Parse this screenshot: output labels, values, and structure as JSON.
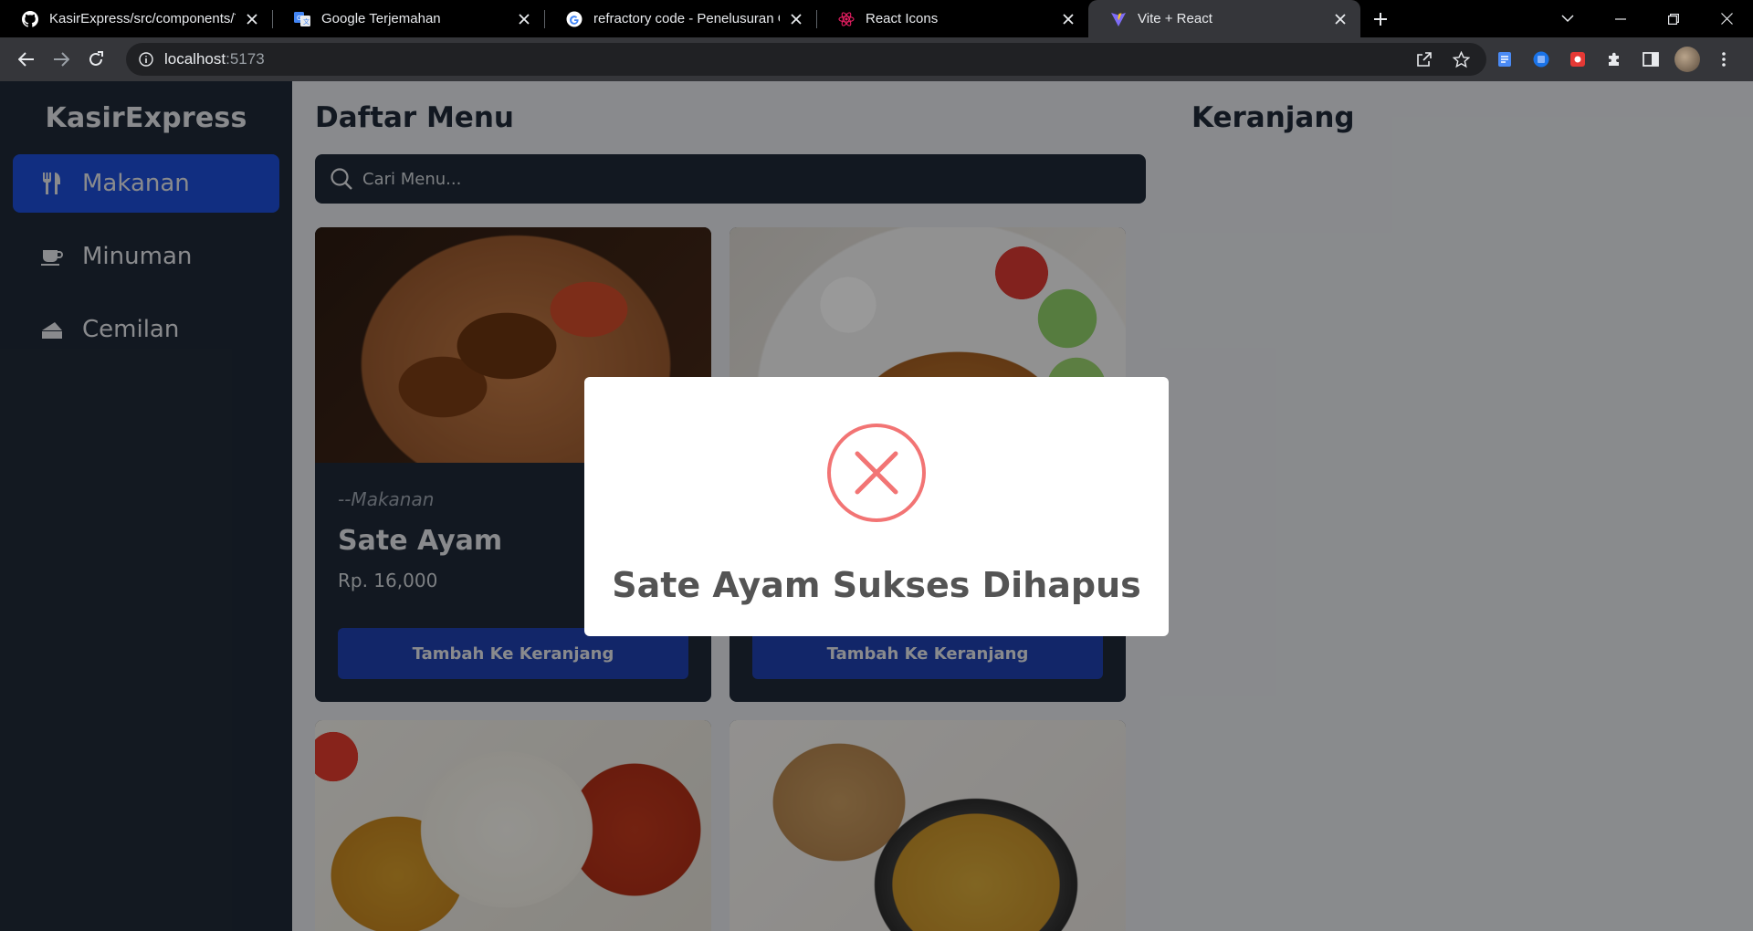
{
  "browser": {
    "tabs": [
      {
        "title": "KasirExpress/src/components/Tot",
        "favicon": "github-icon",
        "active": false
      },
      {
        "title": "Google Terjemahan",
        "favicon": "google-translate-icon",
        "active": false
      },
      {
        "title": "refractory code - Penelusuran Go",
        "favicon": "google-icon",
        "active": false
      },
      {
        "title": "React Icons",
        "favicon": "react-icon",
        "active": false
      },
      {
        "title": "Vite + React",
        "favicon": "vite-icon",
        "active": true
      }
    ],
    "address": {
      "host": "localhost",
      "port": ":5173"
    }
  },
  "app": {
    "brand": "KasirExpress",
    "nav": [
      {
        "label": "Makanan",
        "icon": "utensils-icon",
        "active": true
      },
      {
        "label": "Minuman",
        "icon": "coffee-icon",
        "active": false
      },
      {
        "label": "Cemilan",
        "icon": "cake-icon",
        "active": false
      }
    ],
    "menu_title": "Daftar Menu",
    "search_placeholder": "Cari Menu...",
    "cart_title": "Keranjang",
    "cards": [
      {
        "category": "--Makanan",
        "name": "Sate Ayam",
        "price": "Rp. 16,000",
        "button": "Tambah Ke Keranjang"
      },
      {
        "category": "",
        "name": "",
        "price": "",
        "button": "Tambah Ke Keranjang"
      }
    ]
  },
  "modal": {
    "title": "Sate Ayam Sukses Dihapus",
    "icon": "error-x-icon",
    "accent": "#f27474"
  },
  "colors": {
    "sidebar": "#1f2937",
    "primary": "#1d4ed8",
    "button": "#1e40af"
  }
}
